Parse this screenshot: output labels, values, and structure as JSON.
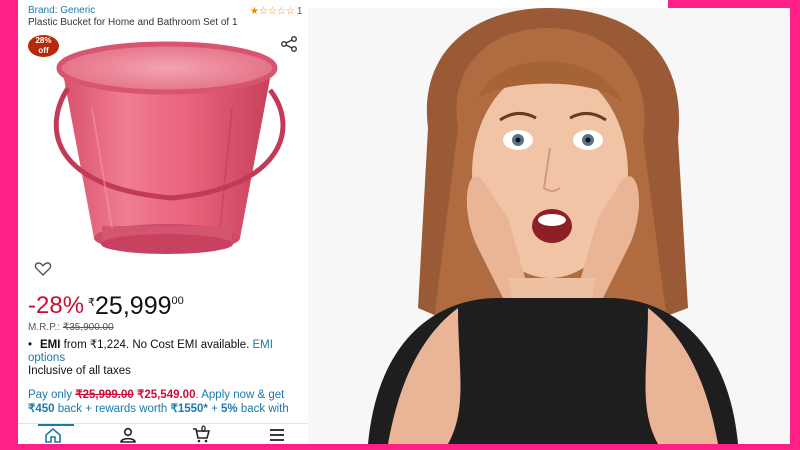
{
  "product": {
    "brand": "Brand: Generic",
    "title": "Plastic Bucket for Home and Bathroom Set of 1",
    "rating_count": "1",
    "rating_value": 1,
    "stars": "★☆☆☆☆",
    "discount_badge_pct": "28%",
    "discount_badge_off": "off"
  },
  "price": {
    "discount": "-28%",
    "currency": "₹",
    "amount": "25,999",
    "decimals": "00",
    "mrp_label": "M.R.P.:",
    "mrp_value": "₹35,900.00"
  },
  "emi": {
    "label": "EMI",
    "text": " from ₹1,224. No Cost EMI available. ",
    "link": "EMI options"
  },
  "taxes": "Inclusive of all taxes",
  "offer": {
    "prefix": "Pay only ",
    "old_price": "₹25,999.00",
    "new_price": "₹25,549.00",
    "mid": ". Apply now & get ",
    "cashback": "₹450",
    "mid2": " back + rewards worth ",
    "rewards": "₹1550*",
    "mid3": " + ",
    "pct": "5%",
    "suffix": " back with"
  },
  "nav": {
    "cart_count": "0"
  },
  "colors": {
    "accent_pink": "#ff1f86",
    "link_blue": "#1b7aa8",
    "discount_red": "#cc0c39",
    "bucket_pink": "#e8607a"
  }
}
